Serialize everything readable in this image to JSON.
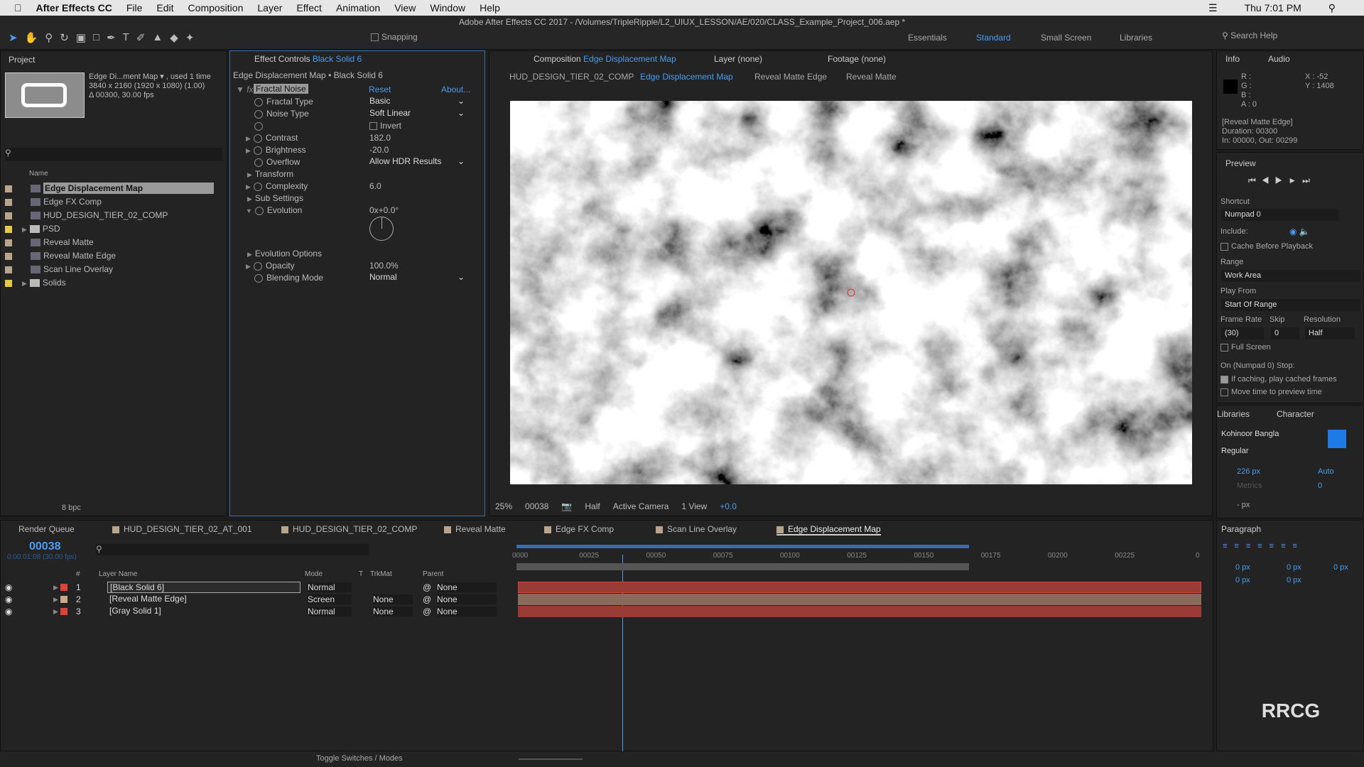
{
  "menubar": {
    "app": "After Effects CC",
    "items": [
      "File",
      "Edit",
      "Composition",
      "Layer",
      "Effect",
      "Animation",
      "View",
      "Window",
      "Help"
    ],
    "clock": "Thu 7:01 PM"
  },
  "window_title": "Adobe After Effects CC 2017 - /Volumes/TripleRipple/L2_UIUX_LESSON/AE/020/CLASS_Example_Project_006.aep *",
  "toolbar": {
    "snapping": "Snapping",
    "workspaces": [
      "Essentials",
      "Standard",
      "Small Screen",
      "Libraries"
    ],
    "active_workspace": "Standard",
    "search": "Search Help"
  },
  "project": {
    "title": "Project",
    "preview_name": "Edge Di...ment Map ▾ , used 1 time",
    "preview_dims": "3840 x 2160  (1920 x 1080) (1.00)",
    "preview_dur": "Δ 00300, 30.00 fps",
    "col_name": "Name",
    "bpc": "8 bpc",
    "items": [
      {
        "name": "Edge Displacement Map",
        "type": "comp",
        "color": "#b9a48c",
        "selected": true
      },
      {
        "name": "Edge FX Comp",
        "type": "comp",
        "color": "#b9a48c"
      },
      {
        "name": "HUD_DESIGN_TIER_02_COMP",
        "type": "comp",
        "color": "#b9a48c"
      },
      {
        "name": "PSD",
        "type": "folder",
        "color": "#e5c94a"
      },
      {
        "name": "Reveal Matte",
        "type": "comp",
        "color": "#b9a48c"
      },
      {
        "name": "Reveal Matte Edge",
        "type": "comp",
        "color": "#b9a48c"
      },
      {
        "name": "Scan Line Overlay",
        "type": "comp",
        "color": "#b9a48c"
      },
      {
        "name": "Solids",
        "type": "folder",
        "color": "#e5c94a"
      }
    ]
  },
  "effect_controls": {
    "title": "Effect Controls",
    "layer": "Black Solid 6",
    "breadcrumb": "Edge Displacement Map • Black Solid 6",
    "effect": "Fractal Noise",
    "reset": "Reset",
    "about": "About...",
    "props": [
      {
        "label": "Fractal Type",
        "value": "Basic",
        "kind": "dropdown"
      },
      {
        "label": "Noise Type",
        "value": "Soft Linear",
        "kind": "dropdown"
      },
      {
        "label": "",
        "value": "Invert",
        "kind": "checkbox"
      },
      {
        "label": "Contrast",
        "value": "182.0",
        "kind": "num"
      },
      {
        "label": "Brightness",
        "value": "-20.0",
        "kind": "num"
      },
      {
        "label": "Overflow",
        "value": "Allow HDR Results",
        "kind": "dropdown"
      },
      {
        "label": "Transform",
        "value": "",
        "kind": "group"
      },
      {
        "label": "Complexity",
        "value": "6.0",
        "kind": "num"
      },
      {
        "label": "Sub Settings",
        "value": "",
        "kind": "group"
      },
      {
        "label": "Evolution",
        "value": "0x+0.0°",
        "kind": "num"
      }
    ],
    "props2": [
      {
        "label": "Evolution Options",
        "value": "",
        "kind": "group"
      },
      {
        "label": "Opacity",
        "value": "100.0%",
        "kind": "num"
      },
      {
        "label": "Blending Mode",
        "value": "Normal",
        "kind": "dropdown"
      }
    ]
  },
  "comp": {
    "tabs": [
      {
        "label": "Composition",
        "name": "Edge Displacement Map"
      },
      {
        "label": "Layer (none)"
      },
      {
        "label": "Footage (none)"
      }
    ],
    "nav": [
      "HUD_DESIGN_TIER_02_COMP",
      "Edge Displacement Map",
      "Reveal Matte Edge",
      "Reveal Matte"
    ],
    "footer": {
      "zoom": "25%",
      "time": "00038",
      "resolution": "Half",
      "camera": "Active Camera",
      "views": "1 View",
      "exposure": "+0.0"
    }
  },
  "info": {
    "tab": "Info",
    "tab2": "Audio",
    "r": "R :",
    "g": "G :",
    "b": "B :",
    "a": "A : 0",
    "x": "X : -52",
    "y": "Y : 1408",
    "layer": "[Reveal Matte Edge]",
    "duration": "Duration: 00300",
    "inout": "In: 00000, Out: 00299"
  },
  "preview": {
    "title": "Preview",
    "shortcut_label": "Shortcut",
    "shortcut": "Numpad 0",
    "include": "Include:",
    "cache": "Cache Before Playback",
    "range_label": "Range",
    "range": "Work Area",
    "playfrom_label": "Play From",
    "playfrom": "Start Of Range",
    "fr_label": "Frame Rate",
    "skip_label": "Skip",
    "res_label": "Resolution",
    "fr": "(30)",
    "skip": "0",
    "res": "Half",
    "fullscreen": "Full Screen",
    "stop_label": "On (Numpad 0) Stop:",
    "cached": "If caching, play cached frames",
    "cached_checked": true,
    "movetime": "Move time to preview time"
  },
  "character": {
    "tab1": "Libraries",
    "tab2": "Character",
    "font": "Kohinoor Bangla",
    "style": "Regular",
    "size": "226 px",
    "leading": "Auto",
    "kerning": "Metrics",
    "tracking": "0",
    "stroke": "- px",
    "fill_color": "#1e7be6"
  },
  "paragraph": {
    "title": "Paragraph",
    "v1": "0 px",
    "v2": "0 px",
    "v3": "0 px",
    "v4": "0 px",
    "v5": "0 px"
  },
  "timeline": {
    "tabs": [
      "Render Queue",
      "HUD_DESIGN_TIER_02_AT_001",
      "HUD_DESIGN_TIER_02_COMP",
      "Reveal Matte",
      "Edge FX Comp",
      "Scan Line Overlay",
      "Edge Displacement Map"
    ],
    "active_tab": "Edge Displacement Map",
    "timecode": "00038",
    "timecode_sub": "0:00:01:08 (30.00 fps)",
    "cols": {
      "num": "#",
      "name": "Layer Name",
      "mode": "Mode",
      "t": "T",
      "trkmat": "TrkMat",
      "parent": "Parent"
    },
    "ruler": [
      "0000",
      "00025",
      "00050",
      "00075",
      "00100",
      "00125",
      "00150",
      "00175",
      "00200",
      "00225",
      "0"
    ],
    "layers": [
      {
        "num": "1",
        "name": "[Black Solid 6]",
        "mode": "Normal",
        "trkmat": "",
        "parent": "None",
        "color": "#d9453c"
      },
      {
        "num": "2",
        "name": "[Reveal Matte Edge]",
        "mode": "Screen",
        "trkmat": "None",
        "parent": "None",
        "color": "#c9a88c"
      },
      {
        "num": "3",
        "name": "[Gray Solid 1]",
        "mode": "Normal",
        "trkmat": "None",
        "parent": "None",
        "color": "#d9453c"
      }
    ],
    "current_frame": 38,
    "work_area": [
      0,
      150
    ],
    "duration": 300,
    "toggle": "Toggle Switches / Modes"
  }
}
